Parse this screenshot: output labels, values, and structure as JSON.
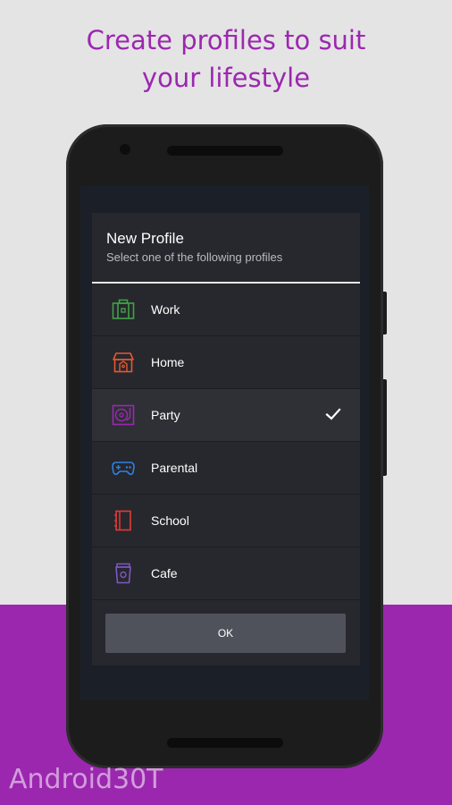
{
  "headline": {
    "line1": "Create profiles to suit",
    "line2": "your lifestyle"
  },
  "dialog": {
    "title": "New Profile",
    "subtitle": "Select one of the following profiles",
    "profiles": [
      {
        "label": "Work",
        "icon": "briefcase-icon",
        "color": "#43a047"
      },
      {
        "label": "Home",
        "icon": "house-icon",
        "color": "#e8572f"
      },
      {
        "label": "Party",
        "icon": "turntable-icon",
        "color": "#9c27b0",
        "selected": true
      },
      {
        "label": "Parental",
        "icon": "gamepad-icon",
        "color": "#2f80e0"
      },
      {
        "label": "School",
        "icon": "notebook-icon",
        "color": "#e53935"
      },
      {
        "label": "Cafe",
        "icon": "coffee-cup-icon",
        "color": "#7e57c2"
      }
    ],
    "ok_label": "OK"
  },
  "watermark": "Android30T",
  "colors": {
    "accent": "#9c27b0",
    "background_top": "#e4e4e4",
    "background_bottom": "#9b27af",
    "dialog_bg": "#26282d",
    "ok_button": "#4f525a"
  }
}
